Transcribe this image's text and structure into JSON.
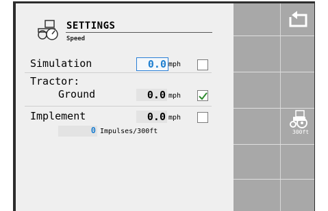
{
  "header": {
    "title": "SETTINGS",
    "subtitle": "Speed"
  },
  "simulation": {
    "label": "Simulation",
    "value": "0.0",
    "unit": "mph",
    "checked": false
  },
  "tractor": {
    "label": "Tractor:",
    "sublabel": "Ground",
    "value": "0.0",
    "unit": "mph",
    "checked": true
  },
  "implement": {
    "label": "Implement",
    "value": "0.0",
    "unit": "mph",
    "checked": false,
    "impulses_value": "0",
    "impulses_label": "Impulses/300ft"
  },
  "rail": {
    "calibrate_label": "300ft"
  },
  "colors": {
    "accent": "#1e7fd0",
    "rail": "#a8a8a8",
    "frame": "#2c2c2c",
    "check": "#2e8b2e"
  }
}
